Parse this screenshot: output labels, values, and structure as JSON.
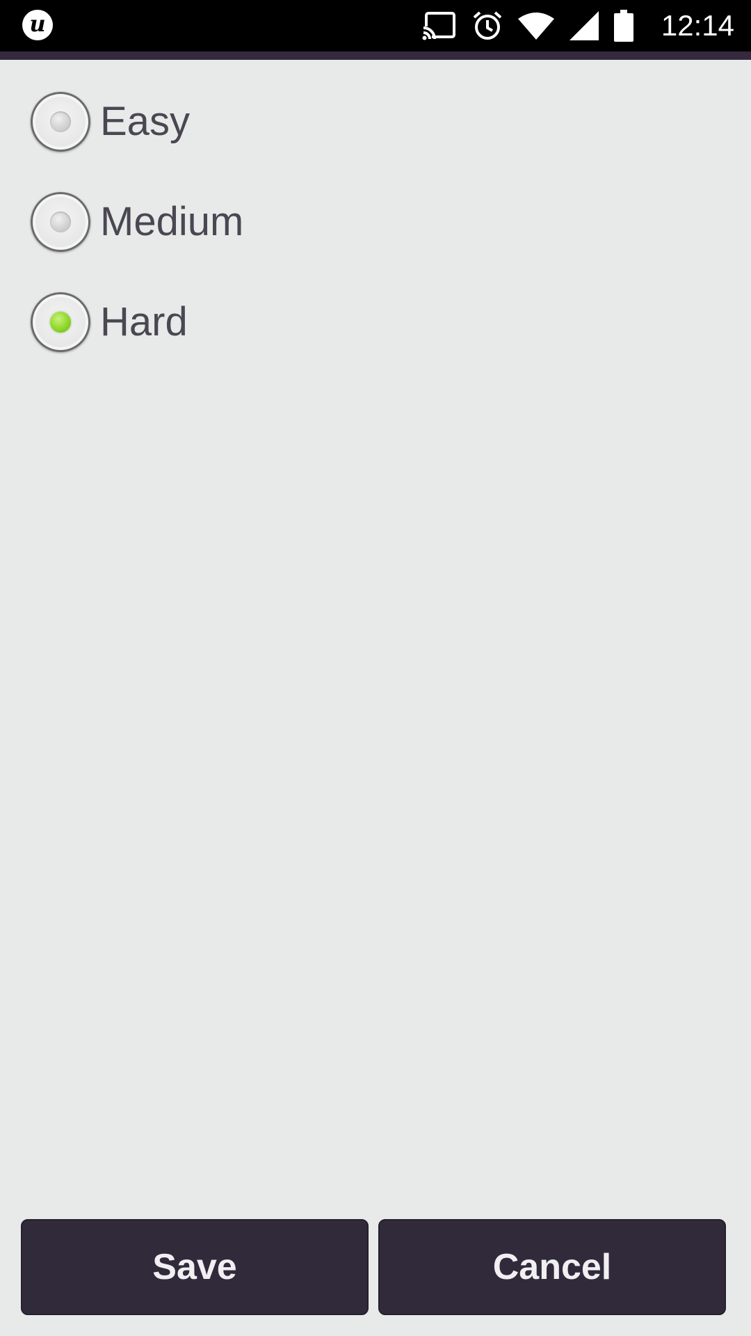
{
  "status_bar": {
    "app_logo_letter": "u",
    "time": "12:14",
    "icons": [
      "cast-icon",
      "alarm-icon",
      "wifi-icon",
      "signal-icon",
      "battery-icon"
    ]
  },
  "difficulty": {
    "options": [
      {
        "label": "Easy",
        "selected": false
      },
      {
        "label": "Medium",
        "selected": false
      },
      {
        "label": "Hard",
        "selected": true
      }
    ]
  },
  "actions": {
    "save_label": "Save",
    "cancel_label": "Cancel"
  },
  "colors": {
    "background": "#e8eaea",
    "button": "#312a3b",
    "accent_strip": "#34293f",
    "selected_dot": "#8ed62a",
    "label_text": "#4a4752"
  }
}
